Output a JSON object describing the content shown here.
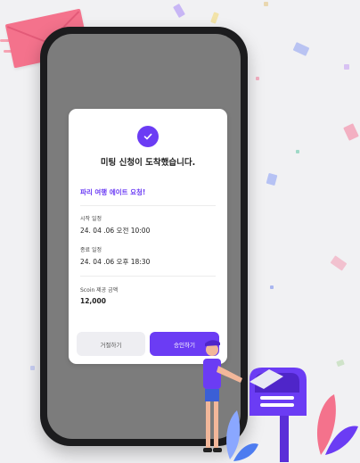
{
  "modal": {
    "title": "미팅 신청이 도착했습니다.",
    "request_title": "파리 여행 에이트 요청!",
    "start_label": "시작 일정",
    "start_value": "24. 04 .06 오전 10:00",
    "end_label": "종료 일정",
    "end_value": "24. 04 .06 오후 18:30",
    "amount_label": "Scoin 제공 금액",
    "amount_value": "12,000",
    "reject_label": "거절하기",
    "approve_label": "승인하기"
  },
  "colors": {
    "accent": "#6b3cf4",
    "envelope": "#f4728c",
    "phone_frame": "#1c1c1e",
    "screen_overlay": "#7c7c7c"
  },
  "icons": [
    "check-icon",
    "envelope-icon",
    "mailbox-icon",
    "person-icon",
    "leaf-icon"
  ]
}
